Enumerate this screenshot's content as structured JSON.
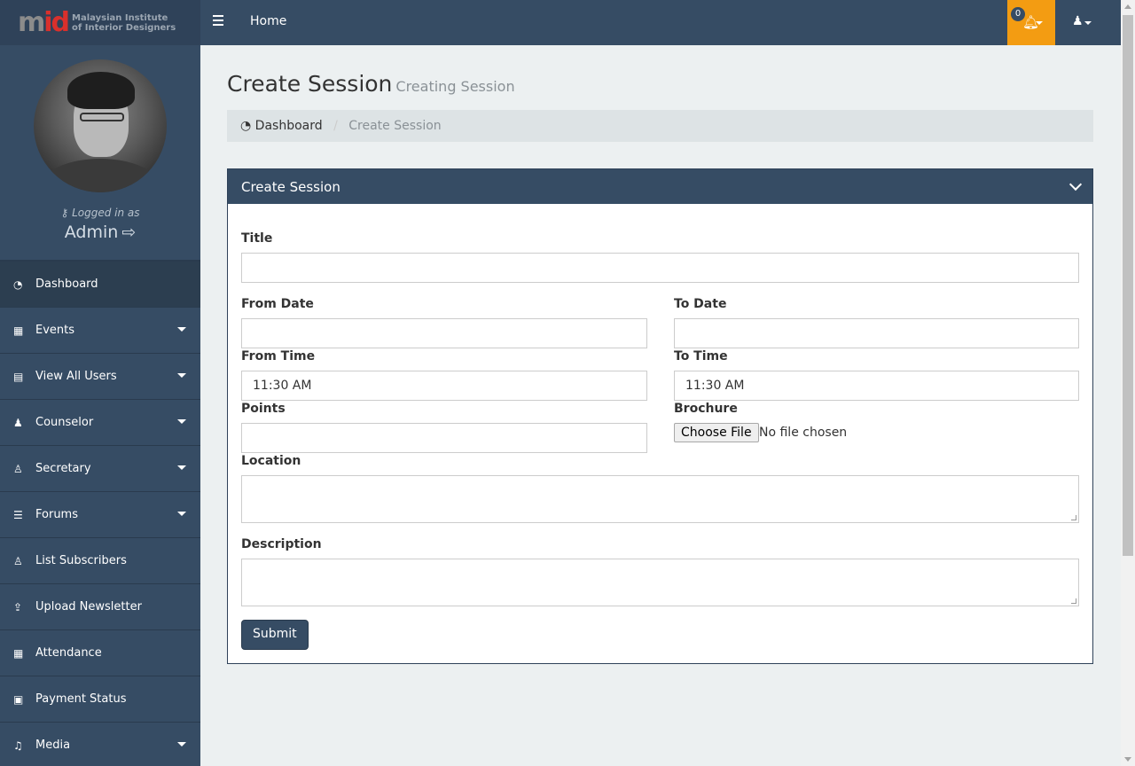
{
  "brand": {
    "logo_mark_1": "m",
    "logo_mark_2": "id",
    "logo_line_1": "Malaysian Institute",
    "logo_line_2": "of Interior Designers"
  },
  "profile": {
    "logged_in_as": "Logged in as",
    "username": "Admin"
  },
  "sidebar": {
    "items": [
      {
        "label": "Dashboard",
        "icon": "dashboard-icon"
      },
      {
        "label": "Events",
        "icon": "calendar-icon"
      },
      {
        "label": "View All Users",
        "icon": "table-icon"
      },
      {
        "label": "Counselor",
        "icon": "users-icon"
      },
      {
        "label": "Secretary",
        "icon": "user-icon"
      },
      {
        "label": "Forums",
        "icon": "list-icon"
      },
      {
        "label": "List Subscribers",
        "icon": "user-icon"
      },
      {
        "label": "Upload Newsletter",
        "icon": "upload-icon"
      },
      {
        "label": "Attendance",
        "icon": "calendar-icon"
      },
      {
        "label": "Payment Status",
        "icon": "money-icon"
      },
      {
        "label": "Media",
        "icon": "music-icon"
      }
    ]
  },
  "topbar": {
    "home": "Home",
    "notification_count": "0"
  },
  "page": {
    "title": "Create Session",
    "subtitle": "Creating Session"
  },
  "breadcrumb": {
    "dashboard": "Dashboard",
    "separator": "/",
    "current": "Create Session"
  },
  "panel": {
    "heading": "Create Session"
  },
  "form": {
    "title_label": "Title",
    "title_value": "",
    "from_date_label": "From Date",
    "from_date_value": "",
    "to_date_label": "To Date",
    "to_date_value": "",
    "from_time_label": "From Time",
    "from_time_value": "11:30 AM",
    "to_time_label": "To Time",
    "to_time_value": "11:30 AM",
    "points_label": "Points",
    "points_value": "",
    "brochure_label": "Brochure",
    "choose_file": "Choose File",
    "no_file": "No file chosen",
    "location_label": "Location",
    "description_label": "Description",
    "submit": "Submit"
  },
  "colors": {
    "sidebar": "#364c64",
    "notification": "#f39c12",
    "background": "#ecf0f1"
  }
}
